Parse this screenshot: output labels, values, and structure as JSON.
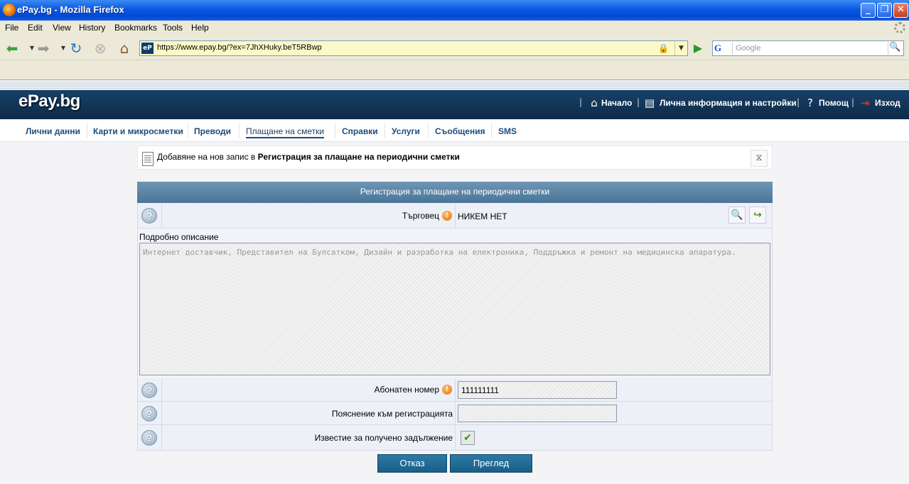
{
  "window": {
    "title": "ePay.bg - Mozilla Firefox",
    "minimize": "_",
    "restore": "❐",
    "close": "✕"
  },
  "menu": [
    "File",
    "Edit",
    "View",
    "History",
    "Bookmarks",
    "Tools",
    "Help"
  ],
  "nav": {
    "url": "https://www.epay.bg/?ex=7JhXHuky.beT5RBwp",
    "favicon": "eP",
    "search_placeholder": "Google",
    "search_engine": "G"
  },
  "header": {
    "logo": "ePay.bg",
    "links": {
      "home": "Начало",
      "profile": "Лична информация и настройки",
      "help": "Помощ",
      "logout": "Изход"
    }
  },
  "tabs": [
    "Лични данни",
    "Карти и микросметки",
    "Преводи",
    "Плащане на сметки",
    "Справки",
    "Услуги",
    "Съобщения",
    "SMS"
  ],
  "active_tab": "Плащане на сметки",
  "breadcrumb": {
    "prefix": "Добавяне на нов запис в ",
    "bold": "Регистрация за плащане на периодични сметки"
  },
  "form": {
    "title": "Регистрация за плащане на периодични сметки",
    "merchant_label": "Търговец",
    "merchant_value": "НИКЕМ НЕТ",
    "description_label": "Подробно описание",
    "description_value": "Интернет доставчик, Представител на Булсатком, Дизайн и разработка на електроника, Поддръжка и ремонт на медицинска апаратура.",
    "subscriber_label": "Абонатен номер",
    "subscriber_value": "111111111",
    "note_label": "Пояснение към регистрацията",
    "note_value": "",
    "notify_label": "Известие за получено задължение",
    "notify_checked": true
  },
  "buttons": {
    "cancel": "Отказ",
    "preview": "Преглед"
  },
  "colors": {
    "header_bg": "#173f66",
    "form_head": "#5a84a6",
    "button": "#1a6a95",
    "tab_text": "#1a4d7c"
  }
}
